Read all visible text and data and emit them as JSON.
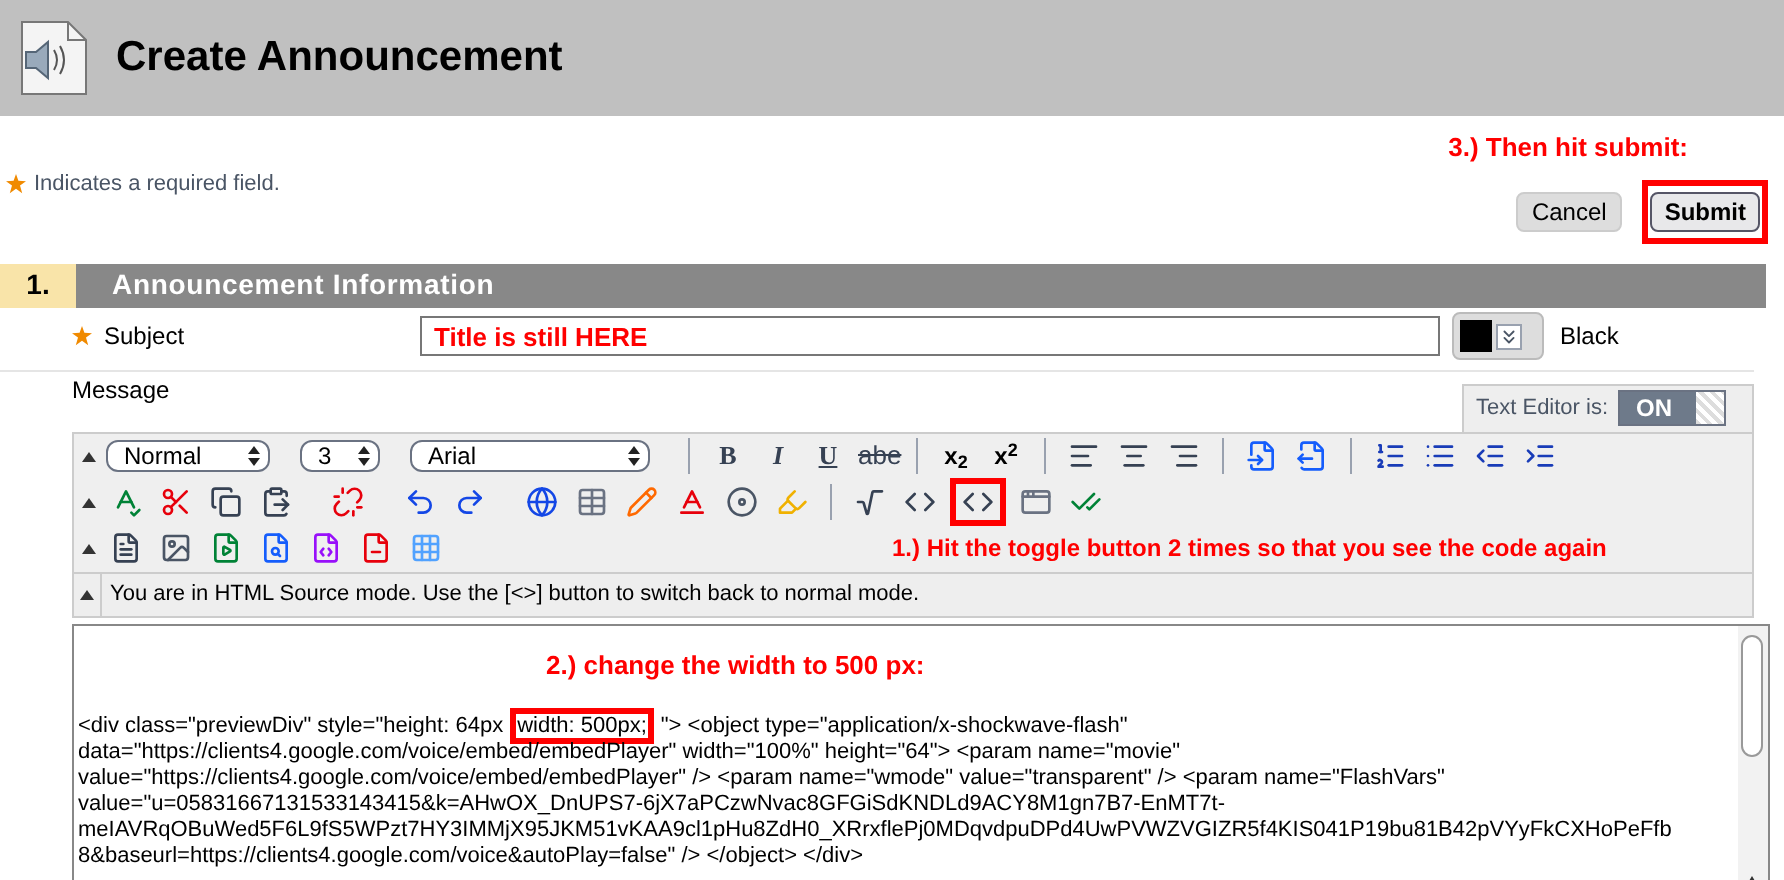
{
  "header": {
    "title": "Create Announcement"
  },
  "required_note": "Indicates a required field.",
  "submit_hint": "3.) Then hit submit:",
  "buttons": [
    {
      "label": "Cancel",
      "kind": "cancel",
      "highlighted": false
    },
    {
      "label": "Submit",
      "kind": "submit",
      "highlighted": true
    }
  ],
  "section": {
    "number": "1.",
    "title": "Announcement Information"
  },
  "subject": {
    "label": "Subject",
    "value": "Title is still HERE",
    "color_name": "Black"
  },
  "message": {
    "label": "Message"
  },
  "text_editor": {
    "label": "Text Editor is:",
    "toggle": "ON",
    "on": true
  },
  "toolbar": {
    "selects": [
      {
        "value": "Normal"
      },
      {
        "value": "3"
      },
      {
        "value": "Arial"
      }
    ],
    "format_buttons": [
      {
        "label": "B",
        "kind": "bold"
      },
      {
        "label": "I",
        "kind": "italic"
      },
      {
        "label": "U",
        "kind": "underline"
      },
      {
        "label": "abe",
        "kind": "strike"
      }
    ],
    "script_buttons": [
      {
        "label": "x$_{2}$"
      },
      {
        "label": "x$^{2}$"
      }
    ],
    "toggle_hint": "1.) Hit the toggle button 2 times so that you see the code again"
  },
  "status": "You are in HTML Source mode. Use the [<>] button to switch back to normal mode.",
  "code_area": {
    "hint": "2.) change the width to 500 px:",
    "lines": [
      [
        {
          "text": "<div class=\"previewDiv\" style=\"height: 64px",
          "highlighted": false
        },
        {
          "text": "width: 500px;",
          "highlighted": true
        },
        {
          "text": "\"> <object type=\"application/x-shockwave-flash\"",
          "highlighted": false
        }
      ],
      [
        {
          "text": "data=\"https://clients4.google.com/voice/embed/embedPlayer\" width=\"100%\" height=\"64\"> <param name=\"movie\"",
          "highlighted": false
        }
      ],
      [
        {
          "text": "value=\"https://clients4.google.com/voice/embed/embedPlayer\" /> <param name=\"wmode\" value=\"transparent\" /> <param name=\"FlashVars\"",
          "highlighted": false
        }
      ],
      [
        {
          "text": "value=\"u=05831667131533143415&k=AHwOX_DnUPS7-6jX7aPCzwNvac8GFGiSdKNDLd9ACY8M1gn7B7-EnMT7t-",
          "highlighted": false
        }
      ],
      [
        {
          "text": "meIAVRqOBuWed5F6L9fS5WPzt7HY3IMMjX95JKM51vKAA9cl1pHu8ZdH0_XRrxflePj0MDqvdpuDPd4UwPVWZVGIZR5f4KIS041P19bu81B42pVYyFkCXHoPeFfb",
          "highlighted": false
        }
      ],
      [
        {
          "text": "8&baseurl=https://clients4.google.com/voice&autoPlay=false\" /> </object> </div>",
          "highlighted": false
        }
      ]
    ]
  }
}
